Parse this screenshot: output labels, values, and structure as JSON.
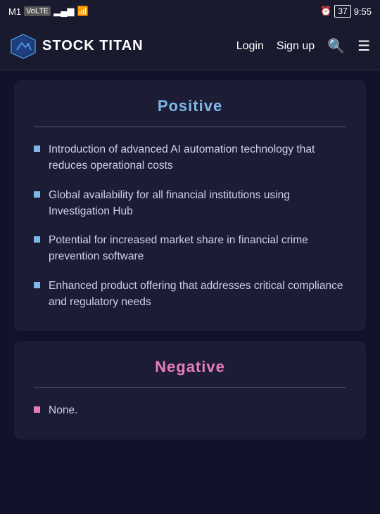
{
  "status_bar": {
    "carrier": "M1",
    "network_type": "VoLTE",
    "signal_bars": "▂▄▆",
    "wifi": "wifi",
    "alarm": "⏰",
    "battery": "37",
    "time": "9:55"
  },
  "navbar": {
    "logo_text": "STOCK TITAN",
    "login_label": "Login",
    "signup_label": "Sign up"
  },
  "positive_section": {
    "title": "Positive",
    "items": [
      "Introduction of advanced AI automation technology that reduces operational costs",
      "Global availability for all financial institutions using Investigation Hub",
      "Potential for increased market share in financial crime prevention software",
      "Enhanced product offering that addresses critical compliance and regulatory needs"
    ]
  },
  "negative_section": {
    "title": "Negative",
    "items": [
      "None."
    ]
  }
}
